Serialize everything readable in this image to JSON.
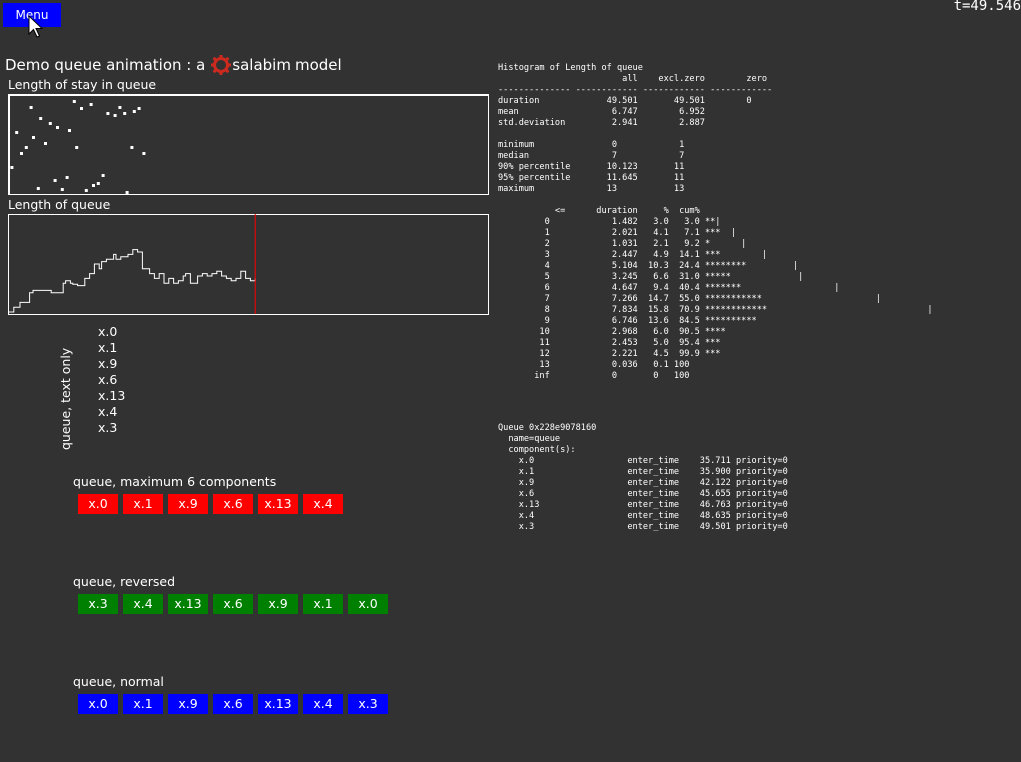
{
  "menu": {
    "label": "Menu"
  },
  "clock": {
    "text": "t=49.546"
  },
  "title": {
    "prefix": "Demo queue animation : a",
    "logo_text": "salabim",
    "suffix": "model"
  },
  "charts": {
    "stay": {
      "label": "Length of stay in queue"
    },
    "length": {
      "label": "Length of queue"
    }
  },
  "chart_data": [
    {
      "type": "scatter",
      "title": "Length of stay in queue",
      "points": [
        [
          0.5,
          0.28
        ],
        [
          1.5,
          0.63
        ],
        [
          2.5,
          0.42
        ],
        [
          3.5,
          0.48
        ],
        [
          4.5,
          0.88
        ],
        [
          5.0,
          0.58
        ],
        [
          6.0,
          0.07
        ],
        [
          6.5,
          0.77
        ],
        [
          7.5,
          0.52
        ],
        [
          8.5,
          0.72
        ],
        [
          9.5,
          0.15
        ],
        [
          10.0,
          0.68
        ],
        [
          11.0,
          0.06
        ],
        [
          12.0,
          0.18
        ],
        [
          12.5,
          0.65
        ],
        [
          13.5,
          0.94
        ],
        [
          14.0,
          0.48
        ],
        [
          15.0,
          0.87
        ],
        [
          16.0,
          0.05
        ],
        [
          17.0,
          0.91
        ],
        [
          17.5,
          0.1
        ],
        [
          18.5,
          0.12
        ],
        [
          19.5,
          0.2
        ],
        [
          20.5,
          0.82
        ],
        [
          22.0,
          0.8
        ],
        [
          23.0,
          0.88
        ],
        [
          24.0,
          0.82
        ],
        [
          24.5,
          0.03
        ],
        [
          25.5,
          0.48
        ],
        [
          26.0,
          0.84
        ],
        [
          27.0,
          0.87
        ],
        [
          28.0,
          0.42
        ]
      ]
    },
    {
      "type": "line",
      "title": "Length of queue",
      "step": true,
      "xlim": [
        0,
        100
      ],
      "ylim": [
        0,
        20
      ],
      "points": [
        [
          0,
          0
        ],
        [
          1.2,
          1
        ],
        [
          2.5,
          2
        ],
        [
          4.5,
          4
        ],
        [
          5.2,
          4.5
        ],
        [
          9,
          4
        ],
        [
          11.5,
          6
        ],
        [
          12,
          6.5
        ],
        [
          13,
          6
        ],
        [
          13.5,
          5.8
        ],
        [
          14.5,
          5.5
        ],
        [
          16,
          7
        ],
        [
          17,
          8
        ],
        [
          18,
          10
        ],
        [
          19,
          9
        ],
        [
          19.5,
          10.5
        ],
        [
          20.5,
          11
        ],
        [
          22,
          12
        ],
        [
          22.5,
          11
        ],
        [
          23.5,
          11.5
        ],
        [
          25,
          12
        ],
        [
          26,
          13
        ],
        [
          27,
          12.5
        ],
        [
          28,
          9
        ],
        [
          29.5,
          8
        ],
        [
          30.5,
          7
        ],
        [
          31.5,
          8
        ],
        [
          32.5,
          6
        ],
        [
          33.5,
          7
        ],
        [
          34.5,
          6
        ],
        [
          35.5,
          6.5
        ],
        [
          36.5,
          7.5
        ],
        [
          37,
          8
        ],
        [
          38,
          6
        ],
        [
          39.5,
          7.5
        ],
        [
          40.5,
          8
        ],
        [
          41.5,
          7.5
        ],
        [
          42.5,
          8
        ],
        [
          43.5,
          8.5
        ],
        [
          44.5,
          7.5
        ],
        [
          45.5,
          7
        ],
        [
          46.5,
          6.5
        ],
        [
          47.5,
          7
        ],
        [
          48.5,
          8.5
        ],
        [
          49,
          8.5
        ],
        [
          49.5,
          7
        ],
        [
          50.5,
          6.5
        ],
        [
          51.5,
          7
        ]
      ],
      "current_time": 51.5
    }
  ],
  "textonly": {
    "label": "queue, text only",
    "items": [
      "x.0",
      "x.1",
      "x.9",
      "x.6",
      "x.13",
      "x.4",
      "x.3"
    ]
  },
  "queues": {
    "max6": {
      "title": "queue, maximum 6 components",
      "color": "#ff0000",
      "items": [
        "x.0",
        "x.1",
        "x.9",
        "x.6",
        "x.13",
        "x.4"
      ]
    },
    "reversed": {
      "title": "queue, reversed",
      "color": "#008000",
      "items": [
        "x.3",
        "x.4",
        "x.13",
        "x.6",
        "x.9",
        "x.1",
        "x.0"
      ]
    },
    "normal": {
      "title": "queue, normal",
      "color": "#0000ff",
      "items": [
        "x.0",
        "x.1",
        "x.9",
        "x.6",
        "x.13",
        "x.4",
        "x.3"
      ]
    }
  },
  "histogram_lines": [
    "Histogram of Length of queue",
    "                        all    excl.zero        zero",
    "-------------- ------------ ------------ ------------",
    "duration             49.501       49.501        0",
    "mean                  6.747        6.952",
    "std.deviation         2.941        2.887",
    "",
    "minimum               0            1",
    "median                7            7",
    "90% percentile       10.123       11",
    "95% percentile       11.645       11",
    "maximum              13           13",
    "",
    "           <=      duration     %  cum%",
    "         0            1.482   3.0   3.0 **|",
    "         1            2.021   4.1   7.1 ***  |",
    "         2            1.031   2.1   9.2 *      |",
    "         3            2.447   4.9  14.1 ***        |",
    "         4            5.104  10.3  24.4 ********         |",
    "         5            3.245   6.6  31.0 *****             |",
    "         6            4.647   9.4  40.4 *******                  |",
    "         7            7.266  14.7  55.0 ***********                      |",
    "         8            7.834  15.8  70.9 ************                               |",
    "         9            6.746  13.6  84.5 **********",
    "        10            2.968   6.0  90.5 ****",
    "        11            2.453   5.0  95.4 ***",
    "        12            2.221   4.5  99.9 ***",
    "        13            0.036   0.1 100",
    "       inf            0       0   100"
  ],
  "queue_print_lines": [
    "Queue 0x228e9078160",
    "  name=queue",
    "  component(s):",
    "    x.0                  enter_time    35.711 priority=0",
    "    x.1                  enter_time    35.900 priority=0",
    "    x.9                  enter_time    42.122 priority=0",
    "    x.6                  enter_time    45.655 priority=0",
    "    x.13                 enter_time    46.763 priority=0",
    "    x.4                  enter_time    48.635 priority=0",
    "    x.3                  enter_time    49.501 priority=0"
  ]
}
